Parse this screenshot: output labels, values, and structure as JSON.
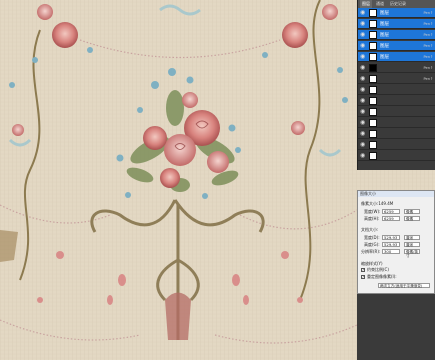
{
  "layers_panel": {
    "tabs": [
      "图层",
      "通道",
      "历史记录"
    ],
    "rows": [
      {
        "name": "图层",
        "mode": "Pen↑",
        "selected": true,
        "thumb": "white"
      },
      {
        "name": "图层",
        "mode": "Pen↑",
        "selected": true,
        "thumb": "white"
      },
      {
        "name": "图层",
        "mode": "Pen↑",
        "selected": true,
        "thumb": "white"
      },
      {
        "name": "图层",
        "mode": "Pen↑",
        "selected": true,
        "thumb": "white"
      },
      {
        "name": "图层",
        "mode": "Pen↑",
        "selected": true,
        "thumb": "white"
      },
      {
        "name": "",
        "mode": "Pen↑",
        "selected": false,
        "thumb": "dark"
      },
      {
        "name": "",
        "mode": "Pen↑",
        "selected": false,
        "thumb": "white"
      },
      {
        "name": "",
        "mode": "",
        "selected": false,
        "thumb": "white"
      },
      {
        "name": "",
        "mode": "",
        "selected": false,
        "thumb": "white"
      },
      {
        "name": "",
        "mode": "",
        "selected": false,
        "thumb": "white"
      },
      {
        "name": "",
        "mode": "",
        "selected": false,
        "thumb": "white"
      },
      {
        "name": "",
        "mode": "",
        "selected": false,
        "thumb": "white"
      },
      {
        "name": "",
        "mode": "",
        "selected": false,
        "thumb": "white"
      },
      {
        "name": "",
        "mode": "",
        "selected": false,
        "thumb": "white"
      }
    ]
  },
  "image_size": {
    "title": "图像大小",
    "pixel_dims": "像素大小:149.4M",
    "width_label": "宽度(W):",
    "width_val": "6259",
    "width_unit": "像素",
    "height_label": "高度(H):",
    "height_val": "6259",
    "height_unit": "像素",
    "doc_size": "文档大小:",
    "doc_w_label": "宽度(D):",
    "doc_w_val": "529.93",
    "doc_w_unit": "厘米",
    "doc_h_label": "高度(G):",
    "doc_h_val": "529.93",
    "doc_h_unit": "厘米",
    "res_label": "分辨率(R):",
    "res_val": "300",
    "res_unit": "像素/英寸",
    "scale_styles": "缩放样式(Y)",
    "constrain": "约束比例(C)",
    "resample": "重定图像像素(I):",
    "resample_method": "两次立方(适用于平滑渐变)"
  }
}
